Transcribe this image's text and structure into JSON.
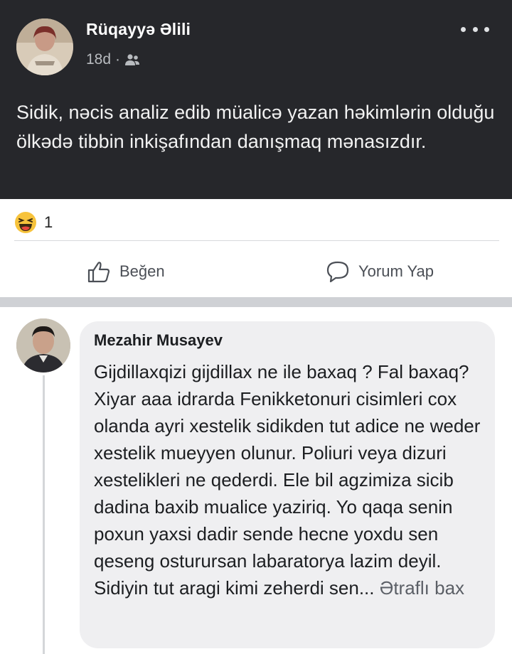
{
  "post": {
    "author": "Rüqayyə Əlili",
    "time": "18d",
    "separator": "·",
    "audience_icon": "friends-icon",
    "more_icon": "more-dots-icon",
    "text": "Sidik, nəcis analiz edib müalicə yazan həkimlərin olduğu ölkədə tibbin inkişafından danışmaq mənasızdır."
  },
  "reactions": {
    "icon": "haha-emoji-icon",
    "count": "1"
  },
  "actions": {
    "like_label": "Beğen",
    "comment_label": "Yorum Yap"
  },
  "comment": {
    "author": "Mezahir Musayev",
    "text": "Gijdillaxqizi gijdillax ne ile baxaq ? Fal baxaq? Xiyar aaa idrarda Fenikketonuri cisimleri cox olanda ayri  xestelik sidikden tut adice ne weder xestelik mueyyen olunur. Poliuri veya dizuri xestelikleri ne qederdi. Ele bil agzimiza sicib dadina baxib mualice yaziriq. Yo qaqa senin poxun yaxsi dadir sende hecne yoxdu sen qeseng osturursan labaratorya lazim deyil. Sidiyin tut aragi kimi zeherdi sen...",
    "see_more": "Ətraflı bax"
  },
  "colors": {
    "post_background": "#26272b",
    "comment_bubble": "#efeff1",
    "page_background": "#ffffff"
  }
}
